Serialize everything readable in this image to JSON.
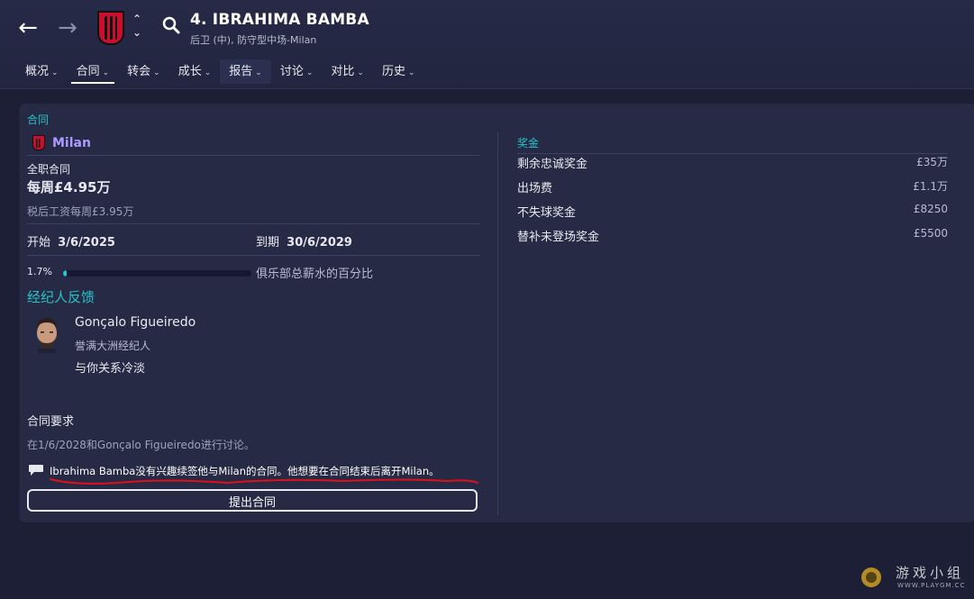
{
  "header": {
    "title": "4. IBRAHIMA BAMBA",
    "subtitle": "后卫 (中), 防守型中场-Milan",
    "tabs": [
      {
        "label": "概况"
      },
      {
        "label": "合同"
      },
      {
        "label": "转会"
      },
      {
        "label": "成长"
      },
      {
        "label": "报告"
      },
      {
        "label": "讨论"
      },
      {
        "label": "对比"
      },
      {
        "label": "历史"
      }
    ]
  },
  "contract": {
    "section_label": "合同",
    "club": "Milan",
    "type": "全职合同",
    "wage": "每周£4.95万",
    "after_tax": "税后工资每周£3.95万",
    "start_label": "开始",
    "start_value": "3/6/2025",
    "end_label": "到期",
    "end_value": "30/6/2029",
    "wage_percent": "1.7%",
    "wage_fraction": 0.017,
    "wage_percent_label": "俱乐部总薪水的百分比"
  },
  "agent": {
    "section_label": "经纪人反馈",
    "name": "Gonçalo Figueiredo",
    "reputation": "誉满大洲经纪人",
    "relationship": "与你关系冷淡"
  },
  "demands": {
    "title": "合同要求",
    "discussion": "在1/6/2028和Gonçalo Figueiredo进行讨论。",
    "message": "Ibrahima Bamba没有兴趣续签他与Milan的合同。他想要在合同结束后离开Milan。",
    "offer_button": "提出合同"
  },
  "bonuses": {
    "section_label": "奖金",
    "items": [
      {
        "label": "剩余忠诚奖金",
        "value": "£35万"
      },
      {
        "label": "出场费",
        "value": "£1.1万"
      },
      {
        "label": "不失球奖金",
        "value": "£8250"
      },
      {
        "label": "替补未登场奖金",
        "value": "£5500"
      }
    ]
  },
  "watermark": {
    "text": "游戏小组",
    "url": "WWW.PLAYGM.CC"
  },
  "colors": {
    "accent": "#29c2c9",
    "club_link": "#a99bff",
    "annotation": "#e0101a"
  }
}
